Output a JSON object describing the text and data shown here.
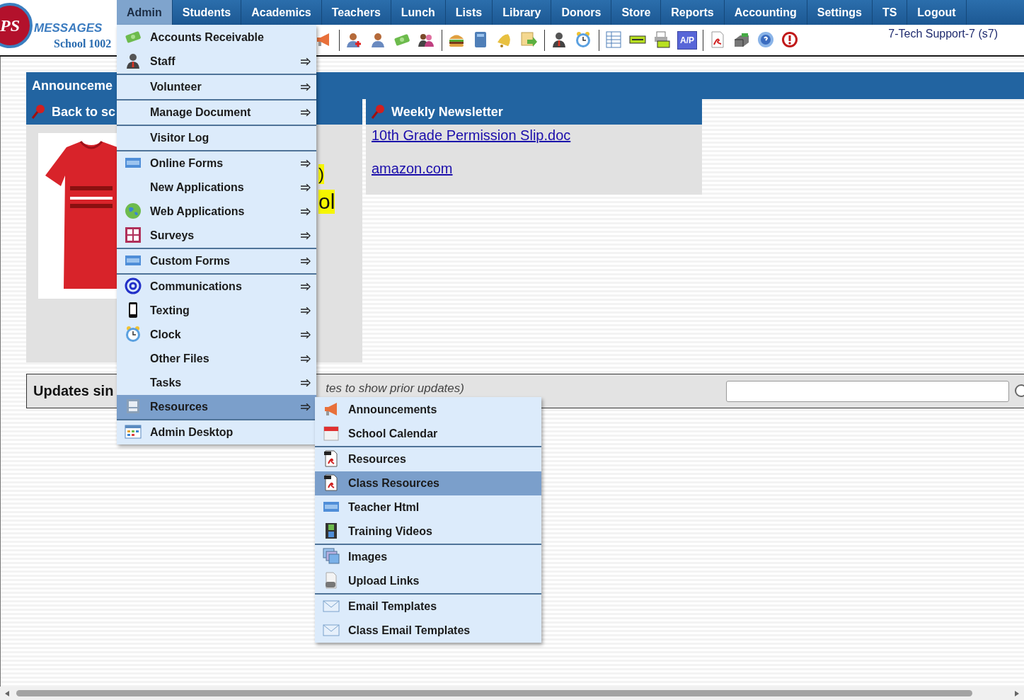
{
  "logo": {
    "mark": "PS",
    "name": "MESSAGES",
    "school": "School 1002"
  },
  "nav": [
    {
      "label": "Admin",
      "selected": true
    },
    {
      "label": "Students",
      "selected": false
    },
    {
      "label": "Academics",
      "selected": false
    },
    {
      "label": "Teachers",
      "selected": false
    },
    {
      "label": "Lunch",
      "selected": false
    },
    {
      "label": "Lists",
      "selected": false
    },
    {
      "label": "Library",
      "selected": false
    },
    {
      "label": "Donors",
      "selected": false
    },
    {
      "label": "Store",
      "selected": false
    },
    {
      "label": "Reports",
      "selected": false
    },
    {
      "label": "Accounting",
      "selected": false
    },
    {
      "label": "Settings",
      "selected": false
    },
    {
      "label": "TS",
      "selected": false
    },
    {
      "label": "Logout",
      "selected": false
    }
  ],
  "toolbar": {
    "ap_label": "A/P"
  },
  "user": "7-Tech Support-7 (s7)",
  "announcements": {
    "title": "Announceme",
    "left_card": {
      "title": "Back to sc",
      "fragments": [
        ")",
        "ol"
      ]
    },
    "right_card": {
      "title": "Weekly Newsletter",
      "links": [
        "10th Grade Permission Slip.doc",
        "amazon.com"
      ]
    }
  },
  "updates": {
    "title": "Updates sin",
    "note": "tes to show prior updates)"
  },
  "admin_menu": {
    "sections": [
      {
        "items": [
          {
            "label": "Accounts Receivable",
            "submenu": false,
            "selected": false
          },
          {
            "label": "Staff",
            "submenu": true,
            "selected": false
          }
        ]
      },
      {
        "items": [
          {
            "label": "Volunteer",
            "submenu": true,
            "selected": false
          }
        ]
      },
      {
        "items": [
          {
            "label": "Manage Document",
            "submenu": true,
            "selected": false
          }
        ]
      },
      {
        "items": [
          {
            "label": "Visitor Log",
            "submenu": false,
            "selected": false
          }
        ]
      },
      {
        "items": [
          {
            "label": "Online Forms",
            "submenu": true,
            "selected": false
          },
          {
            "label": "New Applications",
            "submenu": true,
            "selected": false
          },
          {
            "label": "Web Applications",
            "submenu": true,
            "selected": false
          },
          {
            "label": "Surveys",
            "submenu": true,
            "selected": false
          }
        ]
      },
      {
        "items": [
          {
            "label": "Custom Forms",
            "submenu": true,
            "selected": false
          }
        ]
      },
      {
        "items": [
          {
            "label": "Communications",
            "submenu": true,
            "selected": false
          },
          {
            "label": "Texting",
            "submenu": true,
            "selected": false
          },
          {
            "label": "Clock",
            "submenu": true,
            "selected": false
          },
          {
            "label": "Other Files",
            "submenu": true,
            "selected": false
          },
          {
            "label": "Tasks",
            "submenu": true,
            "selected": false
          },
          {
            "label": "Resources",
            "submenu": true,
            "selected": true
          }
        ]
      },
      {
        "items": [
          {
            "label": "Admin Desktop",
            "submenu": false,
            "selected": false
          }
        ]
      }
    ]
  },
  "resources_submenu": {
    "sections": [
      {
        "items": [
          {
            "label": "Announcements",
            "selected": false
          },
          {
            "label": "School Calendar",
            "selected": false
          }
        ]
      },
      {
        "items": [
          {
            "label": "Resources",
            "selected": false
          },
          {
            "label": "Class Resources",
            "selected": true
          },
          {
            "label": "Teacher Html",
            "selected": false
          },
          {
            "label": "Training Videos",
            "selected": false
          }
        ]
      },
      {
        "items": [
          {
            "label": "Images",
            "selected": false
          },
          {
            "label": "Upload Links",
            "selected": false
          }
        ]
      },
      {
        "items": [
          {
            "label": "Email Templates",
            "selected": false
          },
          {
            "label": "Class Email Templates",
            "selected": false
          }
        ]
      }
    ]
  }
}
